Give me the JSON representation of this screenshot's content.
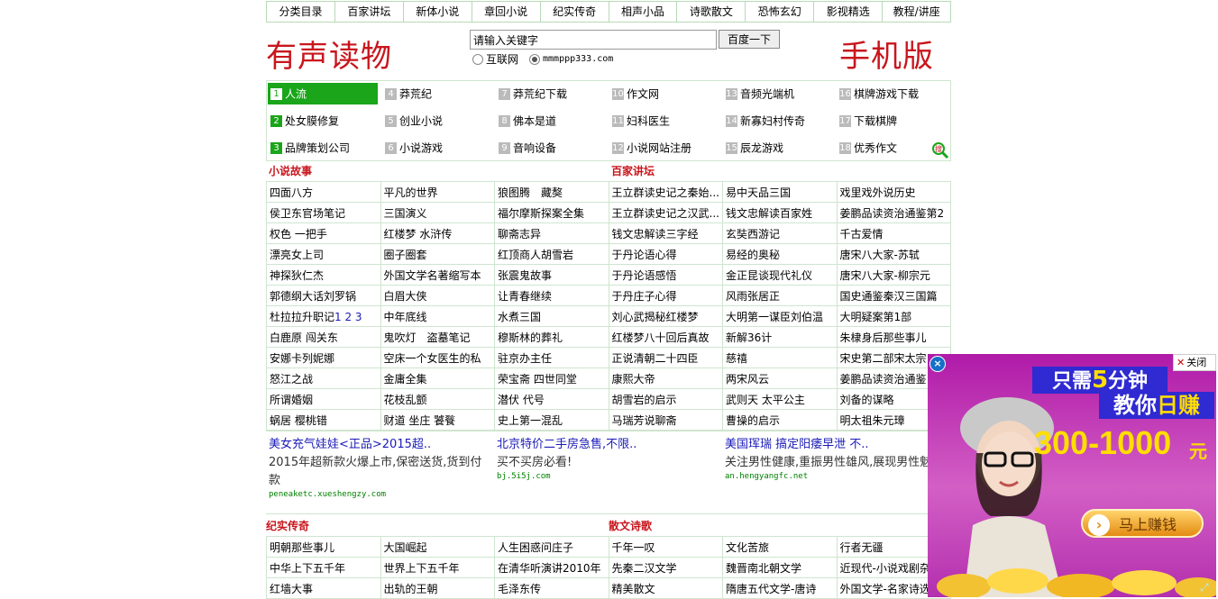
{
  "nav": [
    "分类目录",
    "百家讲坛",
    "新体小说",
    "章回小说",
    "纪实传奇",
    "相声小品",
    "诗歌散文",
    "恐怖玄幻",
    "影视精选",
    "教程/讲座"
  ],
  "header": {
    "logo_left": "有声读物",
    "logo_right": "手机版",
    "search_value": "请输入关键字",
    "search_button": "百度一下",
    "radio_web": "互联网",
    "radio_site": "mmmppp333.com"
  },
  "rank": [
    [
      "1",
      "人流"
    ],
    [
      "2",
      "处女膜修复"
    ],
    [
      "3",
      "品牌策划公司"
    ],
    [
      "4",
      "莽荒纪"
    ],
    [
      "5",
      "创业小说"
    ],
    [
      "6",
      "小说游戏"
    ],
    [
      "7",
      "莽荒纪下载"
    ],
    [
      "8",
      "佛本是道"
    ],
    [
      "9",
      "音响设备"
    ],
    [
      "10",
      "作文网"
    ],
    [
      "11",
      "妇科医生"
    ],
    [
      "12",
      "小说网站注册"
    ],
    [
      "13",
      "音频光端机"
    ],
    [
      "14",
      "新寡妇村传奇"
    ],
    [
      "15",
      "辰龙游戏"
    ],
    [
      "16",
      "棋牌游戏下载"
    ],
    [
      "17",
      "下载棋牌"
    ],
    [
      "18",
      "优秀作文"
    ]
  ],
  "section1": {
    "title_left": "小说故事",
    "title_right": "百家讲坛",
    "rows": [
      [
        "四面八方",
        "平凡的世界",
        "狼图腾　藏獒",
        "王立群读史记之秦始...",
        "易中天品三国",
        "戏里戏外说历史"
      ],
      [
        "侯卫东官场笔记",
        "三国演义",
        "福尔摩斯探案全集",
        "王立群读史记之汉武...",
        "钱文忠解读百家姓",
        "姜鹏品读资治通鉴第2"
      ],
      [
        "权色 一把手",
        "红楼梦 水浒传",
        "聊斋志异",
        "钱文忠解读三字经",
        "玄奘西游记",
        "千古爱情"
      ],
      [
        "漂亮女上司",
        "圈子圈套",
        "红顶商人胡雪岩",
        "于丹论语心得",
        "易经的奥秘",
        "唐宋八大家-苏轼"
      ],
      [
        "神探狄仁杰",
        "外国文学名著缩写本",
        "张震鬼故事",
        "于丹论语感悟",
        "金正昆谈现代礼仪",
        "唐宋八大家-柳宗元"
      ],
      [
        "郭德纲大话刘罗锅",
        "白眉大侠",
        "让青春继续",
        "于丹庄子心得",
        "风雨张居正",
        "国史通鉴秦汉三国篇"
      ],
      [
        "杜拉拉升职记",
        "中年底线",
        "水煮三国",
        "刘心武揭秘红楼梦",
        "大明第一谋臣刘伯温",
        "大明疑案第1部"
      ],
      [
        "白鹿原 闯关东",
        "鬼吹灯　盗墓笔记",
        "穆斯林的葬礼",
        "红楼梦八十回后真故",
        "新解36计",
        "朱棣身后那些事儿"
      ],
      [
        "安娜卡列妮娜",
        "空床一个女医生的私",
        "驻京办主任",
        "正说清朝二十四臣",
        "慈禧",
        "宋史第二部宋太宗"
      ],
      [
        "怒江之战",
        "金庸全集",
        "荣宝斋 四世同堂",
        "康熙大帝",
        "两宋风云",
        "姜鹏品读资治通鉴"
      ],
      [
        "所谓婚姻",
        "花枝乱颤",
        "潜伏 代号",
        "胡雪岩的启示",
        "武则天 太平公主",
        "刘备的谋略"
      ],
      [
        "蜗居 樱桃错",
        "财道 坐庄 饕餮",
        "史上第一混乱",
        "马瑞芳说聊斋",
        "曹操的启示",
        "明太祖朱元璋"
      ]
    ],
    "dulala_pages": "1 2 3"
  },
  "ads": [
    {
      "title": "美女充气娃娃<正品>2015超..",
      "desc": "2015年超新款火爆上市,保密送货,货到付款",
      "url": "peneaketc.xueshengzy.com"
    },
    {
      "title": "北京特价二手房急售,不限..",
      "desc": "买不买房必看!",
      "url": "bj.5i5j.com"
    },
    {
      "title": "美国珲瑞 搞定阳痿早泄 不..",
      "desc": "关注男性健康,重振男性雄风,展现男性魅力,",
      "url": "an.hengyangfc.net"
    }
  ],
  "section2": {
    "title_left": "纪实传奇",
    "title_right": "散文诗歌",
    "rows": [
      [
        "明朝那些事儿",
        "大国崛起",
        "人生困惑问庄子",
        "千年一叹",
        "文化苦旅",
        "行者无疆"
      ],
      [
        "中华上下五千年",
        "世界上下五千年",
        "在清华听演讲2010年",
        "先秦二汉文学",
        "魏晋南北朝文学",
        "近现代-小说戏剧杂"
      ],
      [
        "红墙大事",
        "出轨的王朝",
        "毛泽东传",
        "精美散文",
        "隋唐五代文学-唐诗",
        "外国文学-名家诗选"
      ]
    ]
  },
  "float_ad": {
    "close_label": "关闭",
    "line1_a": "只需",
    "line1_num": "5",
    "line1_b": "分钟",
    "line2_a": "教你",
    "line2_b": "日赚",
    "amount": "300-1000",
    "unit": "元",
    "button": "马上赚钱"
  }
}
